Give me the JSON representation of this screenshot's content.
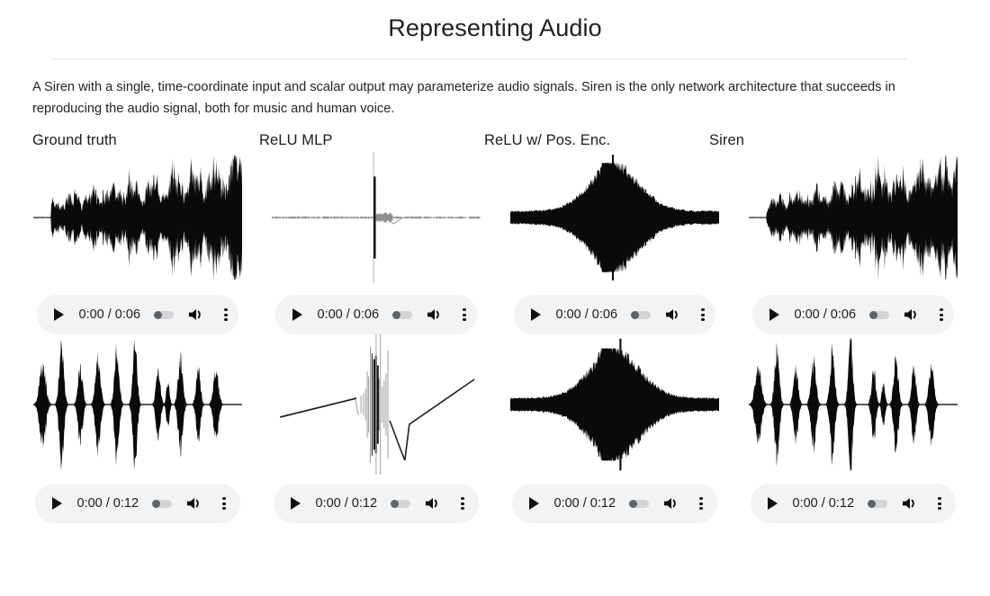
{
  "page": {
    "title": "Representing Audio",
    "intro": "A Siren with a single, time-coordinate input and scalar output may parameterize audio signals. Siren is the only network architecture that succeeds in reproducing the audio signal, both for music and human voice."
  },
  "columns": [
    {
      "id": "ground-truth",
      "label": "Ground truth"
    },
    {
      "id": "relu-mlp",
      "label": "ReLU MLP"
    },
    {
      "id": "relu-pos-enc",
      "label": "ReLU w/ Pos. Enc."
    },
    {
      "id": "siren",
      "label": "Siren"
    }
  ],
  "players": {
    "play_icon": "play-icon",
    "volume_icon": "volume-icon",
    "menu_icon": "more-options-icon",
    "seek_icon": "seek-slider"
  },
  "rows": [
    {
      "id": "music",
      "duration_label": "0:00 / 0:06",
      "current_time": "0:00",
      "duration": "0:06",
      "cells": [
        {
          "column": "ground-truth",
          "waveform": "music-growing",
          "seed": 11
        },
        {
          "column": "relu-mlp",
          "waveform": "flat-spike",
          "seed": 22
        },
        {
          "column": "relu-pos-enc",
          "waveform": "spindle",
          "seed": 33
        },
        {
          "column": "siren",
          "waveform": "music-growing",
          "seed": 44
        }
      ]
    },
    {
      "id": "voice",
      "duration_label": "0:00 / 0:12",
      "current_time": "0:00",
      "duration": "0:12",
      "cells": [
        {
          "column": "ground-truth",
          "waveform": "voice-bursts",
          "seed": 55
        },
        {
          "column": "relu-mlp",
          "waveform": "ramps-spike",
          "seed": 66
        },
        {
          "column": "relu-pos-enc",
          "waveform": "spindle-spike",
          "seed": 77
        },
        {
          "column": "siren",
          "waveform": "voice-bursts",
          "seed": 88
        }
      ]
    }
  ],
  "colors": {
    "background": "#ffffff",
    "text": "#202124",
    "divider": "#e4e6e8",
    "player_bg": "#f1f3f4",
    "waveform_dark": "#0a0a0a",
    "waveform_grey": "#9a9a9a",
    "icon": "#0f0f0f"
  }
}
